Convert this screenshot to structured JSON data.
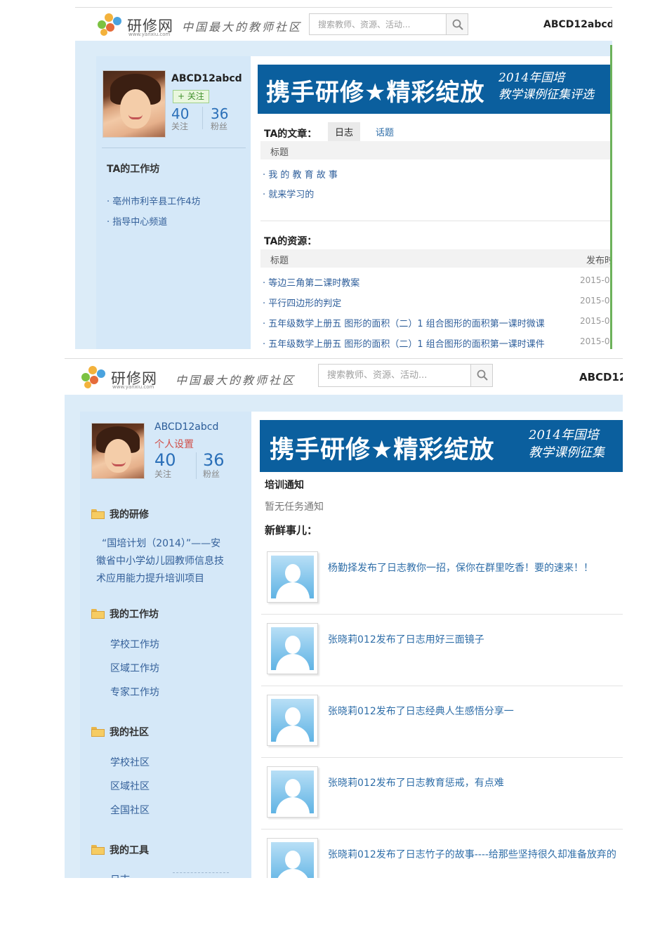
{
  "site": {
    "logo_text": "研修网",
    "logo_url": "www.yanxiu.com",
    "slogan": "中国最大的教师社区",
    "search_placeholder": "搜索教师、资源、活动...",
    "username": "ABCD12abcd"
  },
  "banner": {
    "title": "携手研修★精彩绽放",
    "sub_line1": "2014年国培",
    "sub_line2_top": "教学课例征集评选",
    "sub_line2_bottom": "教学课例征集"
  },
  "shot1": {
    "profile": {
      "name": "ABCD12abcd",
      "follow_label": "+ 关注",
      "following_count": "40",
      "following_label": "关注",
      "fans_count": "36",
      "fans_label": "粉丝"
    },
    "workshop": {
      "heading": "TA的工作坊",
      "links": [
        "· 亳州市利辛县工作4坊",
        "· 指导中心频道"
      ]
    },
    "articles": {
      "heading": "TA的文章：",
      "tabs": [
        "日志",
        "话题"
      ],
      "col_title": "标题",
      "items": [
        "· 我 的 教 育 故 事",
        "· 就来学习的"
      ]
    },
    "resources": {
      "heading": "TA的资源：",
      "col_title": "标题",
      "col_date": "发布时",
      "items": [
        {
          "title": "· 等边三角第二课时教案",
          "date": "2015-0"
        },
        {
          "title": "· 平行四边形的判定",
          "date": "2015-0"
        },
        {
          "title": "· 五年级数学上册五 图形的面积（二）1 组合图形的面积第一课时微课",
          "date": "2015-0"
        },
        {
          "title": "· 五年级数学上册五 图形的面积（二）1 组合图形的面积第一课时课件",
          "date": "2015-0"
        }
      ]
    }
  },
  "shot2": {
    "profile": {
      "name": "ABCD12abcd",
      "settings_label": "个人设置",
      "following_count": "40",
      "following_label": "关注",
      "fans_count": "36",
      "fans_label": "粉丝"
    },
    "menu": {
      "my_training": {
        "heading": "我的研修",
        "lines": [
          "“国培计划（2014）”——安",
          "徽省中小学幼儿园教师信息技",
          "术应用能力提升培训项目"
        ]
      },
      "my_workshop": {
        "heading": "我的工作坊",
        "links": [
          "学校工作坊",
          "区域工作坊",
          "专家工作坊"
        ]
      },
      "my_community": {
        "heading": "我的社区",
        "links": [
          "学校社区",
          "区域社区",
          "全国社区"
        ]
      },
      "my_tools": {
        "heading": "我的工具",
        "partial": "日志"
      }
    },
    "notice": {
      "heading": "培训通知",
      "empty": "暂无任务通知"
    },
    "feed": {
      "heading": "新鲜事儿：",
      "items": [
        "杨勤择发布了日志教你一招，保你在群里吃香！要的速来！！",
        "张晓莉012发布了日志用好三面镜子",
        "张晓莉012发布了日志经典人生感悟分享一",
        "张晓莉012发布了日志教育惩戒，有点难",
        "张晓莉012发布了日志竹子的故事----给那些坚持很久却准备放弃的"
      ]
    }
  }
}
